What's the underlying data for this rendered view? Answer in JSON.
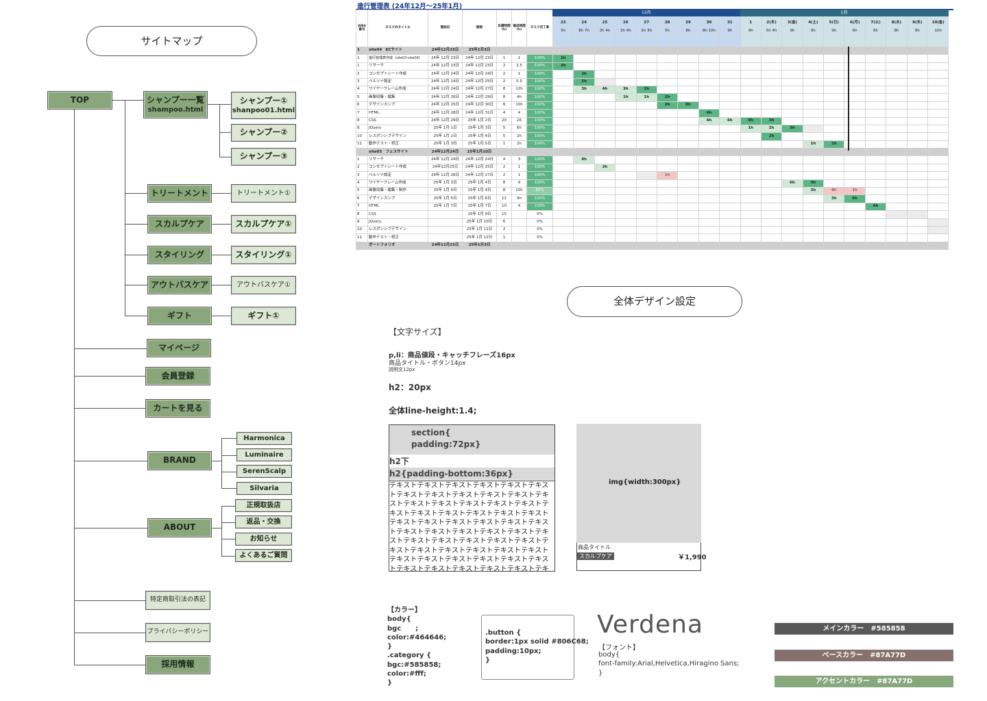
{
  "sitemap": {
    "title": "サイトマップ",
    "top": "TOP",
    "shampoo_list": "シャンプー一覧",
    "shampoo_list_file": "shampoo.html",
    "shampoo1": "シャンプー①",
    "shampoo1_file": "shanpoo01.html",
    "shampoo2": "シャンプー②",
    "shampoo3": "シャンプー③",
    "treatment": "トリートメント",
    "treatment1": "トリートメント①",
    "scalp": "スカルプケア",
    "scalp1": "スカルプケア①",
    "styling": "スタイリング",
    "styling1": "スタイリング①",
    "outbath": "アウトバスケア",
    "outbath1": "アウトバスケア①",
    "gift": "ギフト",
    "gift1": "ギフト①",
    "mypage": "マイページ",
    "register": "会員登録",
    "cart": "カートを見る",
    "brand": "BRAND",
    "brands": [
      "Harmonica",
      "Luminaire",
      "SerenScalp",
      "Silvaria"
    ],
    "about": "ABOUT",
    "abouts": [
      "正規取扱店",
      "返品・交換",
      "お知らせ",
      "よくあるご質問"
    ],
    "tokutei": "特定商取引法の表記",
    "privacy": "プライバシーポリシー",
    "recruit": "採用情報"
  },
  "gantt": {
    "title": "進行管理表 (24年12月～25年1月)",
    "headers": {
      "wbs": "WBS番号",
      "task": "タスクのタイトル",
      "start": "開始日",
      "end": "期限",
      "plan": "目標時間(h)",
      "actual": "達成時間(h)",
      "rate": "タスク完了率"
    },
    "months": [
      "12月",
      "1月"
    ],
    "days": [
      "23",
      "24",
      "25",
      "26",
      "27",
      "28",
      "29",
      "30",
      "31",
      "1",
      "2(木)",
      "3(金)",
      "4(土)",
      "5(日)",
      "6(月)",
      "7(火)",
      "8(水)",
      "9(木)",
      "10(金)"
    ],
    "dayhours": [
      "5h",
      "8h 7h",
      "3h 4h",
      "3h 4h",
      "2h 3h",
      "5h",
      "8h",
      "8h 10h",
      "9h",
      "9h",
      "5h 4h",
      "9h",
      "9h",
      "9h",
      "6h",
      "8h",
      "8h",
      "8h",
      "10h"
    ],
    "rows": [
      {
        "type": "sec",
        "wbs": "1",
        "task": "site04　ECサイト",
        "start": "24年12月23日",
        "end": "25年1月3日",
        "plan": "",
        "actual": "",
        "rate": ""
      },
      {
        "wbs": "1",
        "task": "進行管理表作成（site03-site04)",
        "start": "24年 12月 23日",
        "end": "24年 12月 23日",
        "plan": "1",
        "actual": "1",
        "rate": "100%",
        "cells": {
          "0": [
            "1h",
            "c1"
          ]
        }
      },
      {
        "wbs": "1",
        "task": "リサーチ",
        "start": "24年 12月 23日",
        "end": "24年 12月 23日",
        "plan": "2",
        "actual": "2.5",
        "rate": "100%",
        "cells": {
          "0": [
            "2h",
            "c1"
          ]
        }
      },
      {
        "wbs": "2",
        "task": "コンセプトシート作成",
        "start": "24年 12月 24日",
        "end": "24年 12月 24日",
        "plan": "2",
        "actual": "1",
        "rate": "100%",
        "cells": {
          "1": [
            "2h",
            "c1"
          ]
        }
      },
      {
        "wbs": "3",
        "task": "ペルソナ設定",
        "start": "24年 12月 24日",
        "end": "24年 12月 25日",
        "plan": "2",
        "actual": "0.5",
        "rate": "100%",
        "cells": {
          "1": [
            "2h",
            "c1"
          ],
          "2": [
            "",
            "c4"
          ]
        }
      },
      {
        "wbs": "4",
        "task": "ワイヤーフレーム作成",
        "start": "24年 12月 24日",
        "end": "24年 12月 27日",
        "plan": "8",
        "actual": "12h",
        "rate": "100%",
        "cells": {
          "1": [
            "3h",
            "c2"
          ],
          "2": [
            "4h",
            "c2"
          ],
          "3": [
            "3h",
            "c2"
          ],
          "4": [
            "2h",
            "c1"
          ]
        }
      },
      {
        "wbs": "5",
        "task": "画像収集・編集",
        "start": "24年 12月 26日",
        "end": "24年 12月 29日",
        "plan": "8",
        "actual": "4h",
        "rate": "100%",
        "cells": {
          "3": [
            "1h",
            "c2"
          ],
          "4": [
            "1h",
            "c2"
          ],
          "5": [
            "2h",
            "c1"
          ]
        }
      },
      {
        "wbs": "6",
        "task": "デザインカンプ",
        "start": "24年 12月 25日",
        "end": "24年 12月 30日",
        "plan": "8",
        "actual": "10h",
        "rate": "100%",
        "cells": {
          "5": [
            "2h",
            "c1"
          ],
          "6": [
            "8h",
            "c1"
          ]
        }
      },
      {
        "wbs": "7",
        "task": "HTML",
        "start": "24年 12月 28日",
        "end": "24年 12月 31日",
        "plan": "4",
        "actual": "4",
        "rate": "100%",
        "cells": {
          "7": [
            "4h",
            "c1"
          ]
        }
      },
      {
        "wbs": "8",
        "task": "CSS",
        "start": "24年 12月 29日",
        "end": "25年 1月 2日",
        "plan": "20",
        "actual": "26",
        "rate": "100%",
        "cells": {
          "7": [
            "4h",
            "c2"
          ],
          "8": [
            "6h",
            "c2"
          ],
          "9": [
            "8h",
            "c1"
          ],
          "10": [
            "3h",
            "c1"
          ]
        }
      },
      {
        "wbs": "9",
        "task": "JQuery",
        "start": "25年 1月 1日",
        "end": "25年 1月 3日",
        "plan": "5",
        "actual": "6h",
        "rate": "100%",
        "cells": {
          "9": [
            "1h",
            "c2"
          ],
          "10": [
            "2h",
            "c2"
          ],
          "11": [
            "3h",
            "c1"
          ],
          "12": [
            "",
            "c4"
          ]
        }
      },
      {
        "wbs": "10",
        "task": "レスポンシブデザイン",
        "start": "25年 1月 2日",
        "end": "25年 1月 4日",
        "plan": "5",
        "actual": "2h",
        "rate": "100%",
        "cells": {
          "10": [
            "2h",
            "c1"
          ]
        }
      },
      {
        "wbs": "11",
        "task": "動作テスト・修正",
        "start": "25年 1月 3日",
        "end": "25年 1月 5日",
        "plan": "1",
        "actual": "2h",
        "rate": "100%",
        "cells": {
          "12": [
            "1h",
            "c2"
          ],
          "13": [
            "1h",
            "c1"
          ]
        }
      },
      {
        "type": "sec",
        "wbs": "",
        "task": "site03　フェスサイト",
        "start": "24年12月24日",
        "end": "25年1月10日",
        "plan": "",
        "actual": "",
        "rate": ""
      },
      {
        "wbs": "1",
        "task": "リサーチ",
        "start": "24年 12月 24日",
        "end": "24年 12月 24日",
        "plan": "4",
        "actual": "3",
        "rate": "100%",
        "cells": {
          "1": [
            "4h",
            "c2"
          ]
        }
      },
      {
        "wbs": "2",
        "task": "コンセプトシート作成",
        "start": "24年12月25日",
        "end": "24年 12月 25日",
        "plan": "2",
        "actual": "1",
        "rate": "100%",
        "cells": {
          "2": [
            "2h",
            "c2"
          ]
        }
      },
      {
        "wbs": "3",
        "task": "ペルソナ設定",
        "start": "24年 12月 28日",
        "end": "24年 12月 27日",
        "plan": "2",
        "actual": "1",
        "rate": "100%",
        "cells": {
          "4": [
            "",
            "c4"
          ],
          "5": [
            "1h",
            "c3"
          ]
        }
      },
      {
        "wbs": "4",
        "task": "ワイヤーフレーム作成",
        "start": "25年 1月 3日",
        "end": "25年 1月 4日",
        "plan": "8",
        "actual": "9",
        "rate": "100%",
        "cells": {
          "11": [
            "6h",
            "c2"
          ],
          "12": [
            "3h",
            "c1"
          ]
        }
      },
      {
        "wbs": "5",
        "task": "画像収集・編集・制作",
        "start": "25年 1月 4日",
        "end": "25年 1月 4日",
        "plan": "8",
        "actual": "10h",
        "rate": "80%",
        "cells": {
          "12": [
            "3h",
            "c2"
          ],
          "13": [
            "6h",
            "c3"
          ],
          "14": [
            "1h",
            "c3"
          ]
        }
      },
      {
        "wbs": "6",
        "task": "デザインカンプ",
        "start": "25年 1月 5日",
        "end": "25年 1月 6日",
        "plan": "12",
        "actual": "9h",
        "rate": "100%",
        "cells": {
          "13": [
            "3h",
            "c2"
          ],
          "14": [
            "6h",
            "c1"
          ]
        }
      },
      {
        "wbs": "7",
        "task": "HTML",
        "start": "25年 1月 7日",
        "end": "25年 1月 7日",
        "plan": "10",
        "actual": "4",
        "rate": "100%",
        "cells": {
          "15": [
            "4h",
            "c1"
          ]
        }
      },
      {
        "wbs": "8",
        "task": "CSS",
        "start": "",
        "end": "25年 1月 9日",
        "plan": "15",
        "actual": "",
        "rate": "0%",
        "cells": {
          "16": [
            "",
            "c4"
          ],
          "17": [
            "",
            "c4"
          ]
        }
      },
      {
        "wbs": "9",
        "task": "JQuery",
        "start": "",
        "end": "25年 1月 10日",
        "plan": "6",
        "actual": "",
        "rate": "0%",
        "cells": {
          "18": [
            "",
            "c4"
          ]
        }
      },
      {
        "wbs": "10",
        "task": "レスポンシブデザイン",
        "start": "",
        "end": "25年 1月 11日",
        "plan": "2",
        "actual": "",
        "rate": "0%",
        "cells": {
          "18": [
            "",
            "c4"
          ]
        }
      },
      {
        "wbs": "11",
        "task": "動作テスト・修正",
        "start": "",
        "end": "25年 1月 12日",
        "plan": "1",
        "actual": "",
        "rate": "0%",
        "cells": {}
      },
      {
        "type": "sec",
        "wbs": "",
        "task": "ポートフォリオ",
        "start": "24年12月23日",
        "end": "25年1月3日",
        "plan": "",
        "actual": "",
        "rate": ""
      }
    ],
    "month_colors": {
      "dec": "#1f4e8c",
      "jan": "#2e6b82"
    }
  },
  "design": {
    "title": "全体デザイン設定",
    "font_size_heading": "【文字サイズ】",
    "fs1": "p,li：商品値段・キャッチフレーズ16px",
    "fs2": "商品タイトル・ボタン14px",
    "fs3": "説明文12px",
    "h2": "h2：20px",
    "lh": "全体line-height:1.4;",
    "section1": "section{",
    "section2": "padding:72px}",
    "h2under": "h2下",
    "h2pad": "h2{padding-bottom:36px}",
    "dummy_text": "テキストテキストテキストテキストテキストテキストテキストテキストテキストテキストテキストテキストテキストテキストテキストテキストテキストテキストテキストテキストテキストテキストテキストテキストテキストテキストテキストテキストテキストテキストテキストテキストテキストテキストテキストテキストテキストテキストテキストテキストテキストテキストテキストテキストテキストテキストテキストテキストテキストテキストテキストテキストテキストテキストテキストテキストテキストテキストテキストテキストテキストテキストテキストテキストテキストテキストテキストテキストテキストテキストテキストテキストテキスト",
    "img_label": "img{width:300px}",
    "product_title": "商品タイトル",
    "product_tag": "スカルプケア",
    "product_price": "￥1,990",
    "color_code": "【カラー】\nbody{\nbgc      ;\ncolor:#464646;\n}\n.category {\nbgc:#585858;\ncolor:#fff;\n}",
    "button_code": ".button {\nborder:1px solid #806C68;\npadding:10px;\n}",
    "font_big": "Verdena",
    "font_heading": "【フォント】",
    "font_code1": "body{",
    "font_code2": "font-family:Arial,Helvetica,Hiragino Sans;",
    "font_code3": "}",
    "colors": [
      {
        "label": "メインカラー　#585858",
        "hex": "#585858"
      },
      {
        "label": "ベースカラー　#87A77D",
        "hex": "#87716c"
      },
      {
        "label": "アクセントカラー　#87A77D",
        "hex": "#87a77d"
      }
    ]
  }
}
